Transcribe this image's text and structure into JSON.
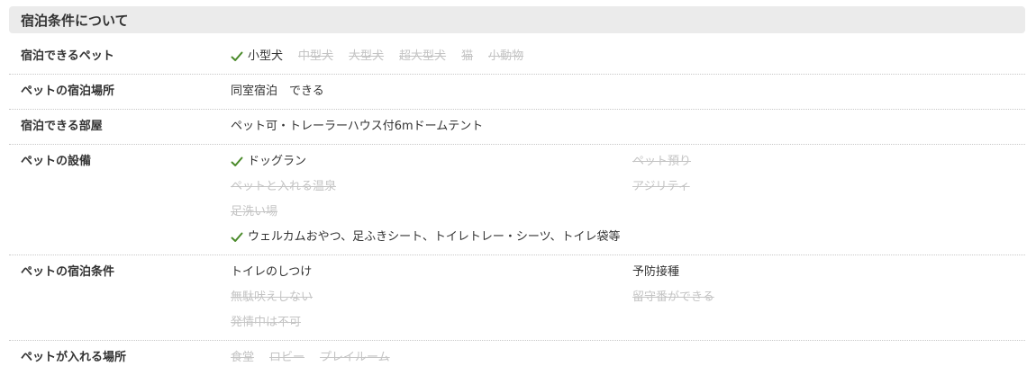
{
  "section_title": "宿泊条件について",
  "colors": {
    "check": "#4a8a2a",
    "disabled_text": "#c4c4c4",
    "header_bg": "#ebebeb"
  },
  "rows": [
    {
      "label": "宿泊できるペット",
      "items": [
        {
          "text": "小型犬",
          "checked": true
        },
        {
          "text": "中型犬",
          "checked": false
        },
        {
          "text": "大型犬",
          "checked": false
        },
        {
          "text": "超大型犬",
          "checked": false
        },
        {
          "text": "猫",
          "checked": false
        },
        {
          "text": "小動物",
          "checked": false
        }
      ]
    },
    {
      "label": "ペットの宿泊場所",
      "value": "同室宿泊　できる"
    },
    {
      "label": "宿泊できる部屋",
      "value": "ペット可・トレーラーハウス付6mドームテント"
    },
    {
      "label": "ペットの設備",
      "items": [
        {
          "text": "ドッグラン",
          "checked": true
        },
        {
          "text": "ペット預り",
          "checked": false
        },
        {
          "text": "ペットと入れる温泉",
          "checked": false
        },
        {
          "text": "アジリティ",
          "checked": false
        },
        {
          "text": "足洗い場",
          "checked": false
        },
        {
          "text": "ウェルカムおやつ、足ふきシート、トイレトレー・シーツ、トイレ袋等",
          "checked": true
        }
      ]
    },
    {
      "label": "ペットの宿泊条件",
      "items": [
        {
          "text": "トイレのしつけ",
          "checked": null
        },
        {
          "text": "予防接種",
          "checked": null
        },
        {
          "text": "無駄吠えしない",
          "checked": false
        },
        {
          "text": "留守番ができる",
          "checked": false
        },
        {
          "text": "発情中は不可",
          "checked": false
        }
      ]
    },
    {
      "label": "ペットが入れる場所",
      "items": [
        {
          "text": "食堂",
          "checked": false
        },
        {
          "text": "ロビー",
          "checked": false
        },
        {
          "text": "プレイルーム",
          "checked": false
        }
      ]
    }
  ]
}
